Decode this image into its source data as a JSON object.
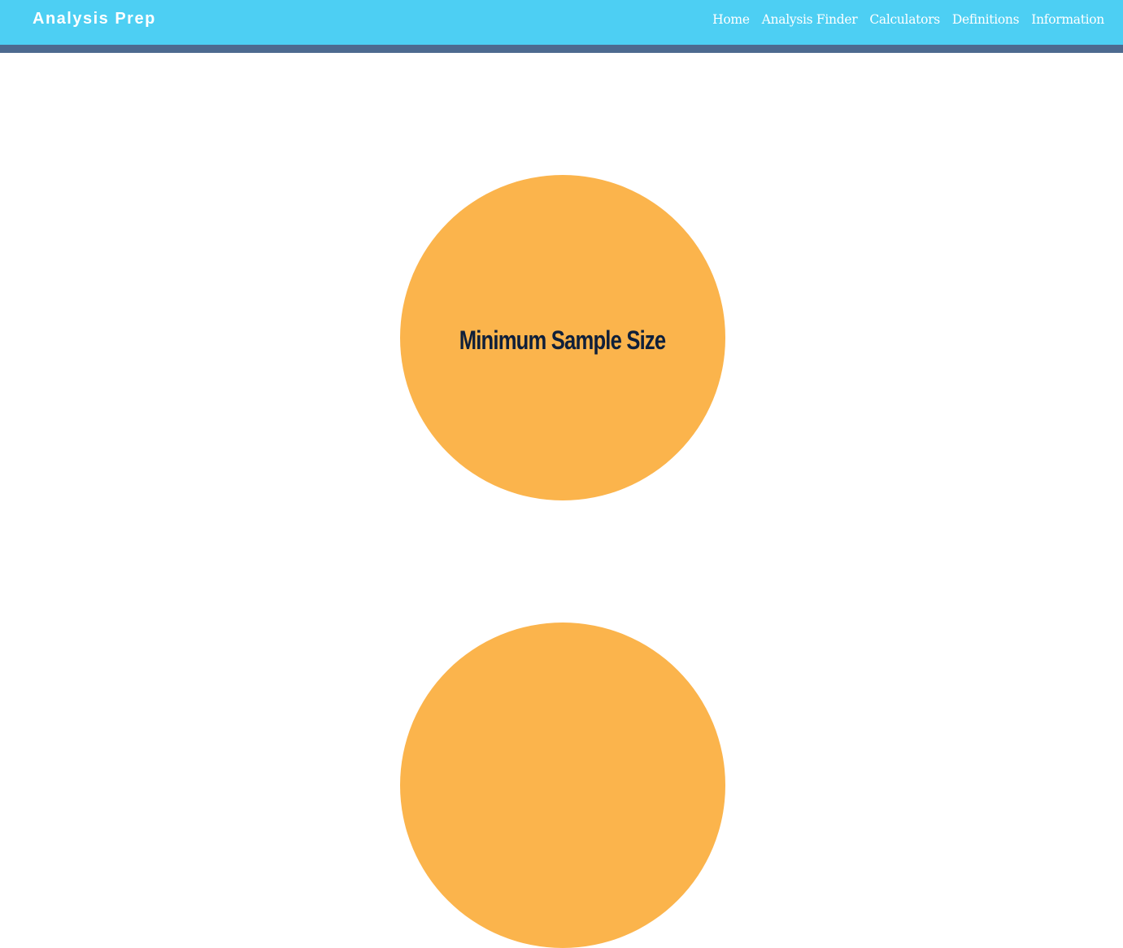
{
  "header": {
    "brand": "Analysis Prep",
    "nav": [
      {
        "label": "Home"
      },
      {
        "label": "Analysis Finder"
      },
      {
        "label": "Calculators"
      },
      {
        "label": "Definitions"
      },
      {
        "label": "Information"
      }
    ]
  },
  "main": {
    "cards": [
      {
        "label": "Minimum Sample Size"
      },
      {
        "label": ""
      }
    ]
  },
  "colors": {
    "header_bg": "#4dcff3",
    "header_stripe": "#4d6a8f",
    "circle_fill": "#fbb44c",
    "circle_text": "#0f1f3a",
    "header_text": "#ffffff"
  }
}
